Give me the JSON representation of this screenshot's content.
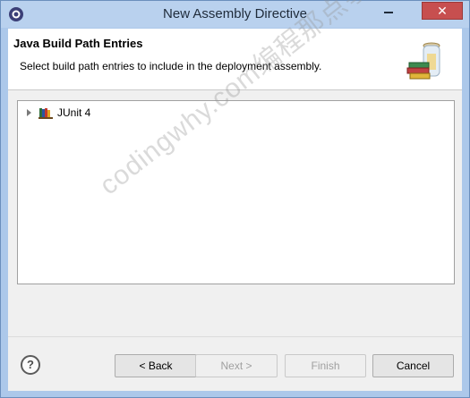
{
  "window": {
    "title": "New Assembly Directive",
    "close_label": "✕",
    "icons": {
      "app": "eclipse-gear-icon",
      "close": "close-icon",
      "minimize": "minimize-icon"
    }
  },
  "banner": {
    "title": "Java Build Path Entries",
    "description": "Select build path entries to include in the deployment assembly.",
    "art_icon": "library-jar-icon"
  },
  "tree": {
    "items": [
      {
        "label": "JUnit 4",
        "icon": "library-icon",
        "expand_icon": "expand-triangle-icon"
      }
    ]
  },
  "footer": {
    "help_glyph": "?",
    "buttons": {
      "back": "< Back",
      "next": "Next >",
      "finish": "Finish",
      "cancel": "Cancel"
    }
  },
  "watermark": "codingwhy.com编程那点事",
  "colors": {
    "frame": "#acc8ea",
    "title_bar": "#b9d1ee",
    "close": "#c74f4f",
    "dialog_bg": "#f0f0f0",
    "disabled_text": "#a0a0a0"
  }
}
